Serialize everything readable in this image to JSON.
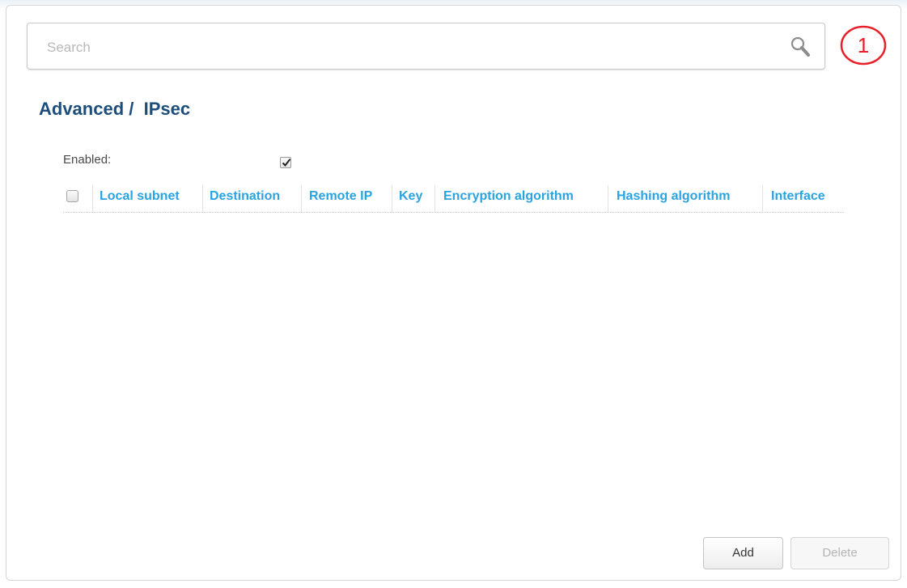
{
  "search": {
    "placeholder": "Search"
  },
  "callout": {
    "number": "1",
    "color": "#e8202a"
  },
  "page": {
    "breadcrumb": "Advanced /  IPsec"
  },
  "settings": {
    "enabled_label": "Enabled:",
    "enabled_checked": true
  },
  "table": {
    "columns": [
      "Local subnet",
      "Destination",
      "Remote IP",
      "Key",
      "Encryption algorithm",
      "Hashing algorithm",
      "Interface"
    ],
    "rows": []
  },
  "buttons": {
    "add": "Add",
    "delete": "Delete"
  },
  "colors": {
    "heading": "#1d4d7a",
    "column_header": "#2aa3e0"
  }
}
